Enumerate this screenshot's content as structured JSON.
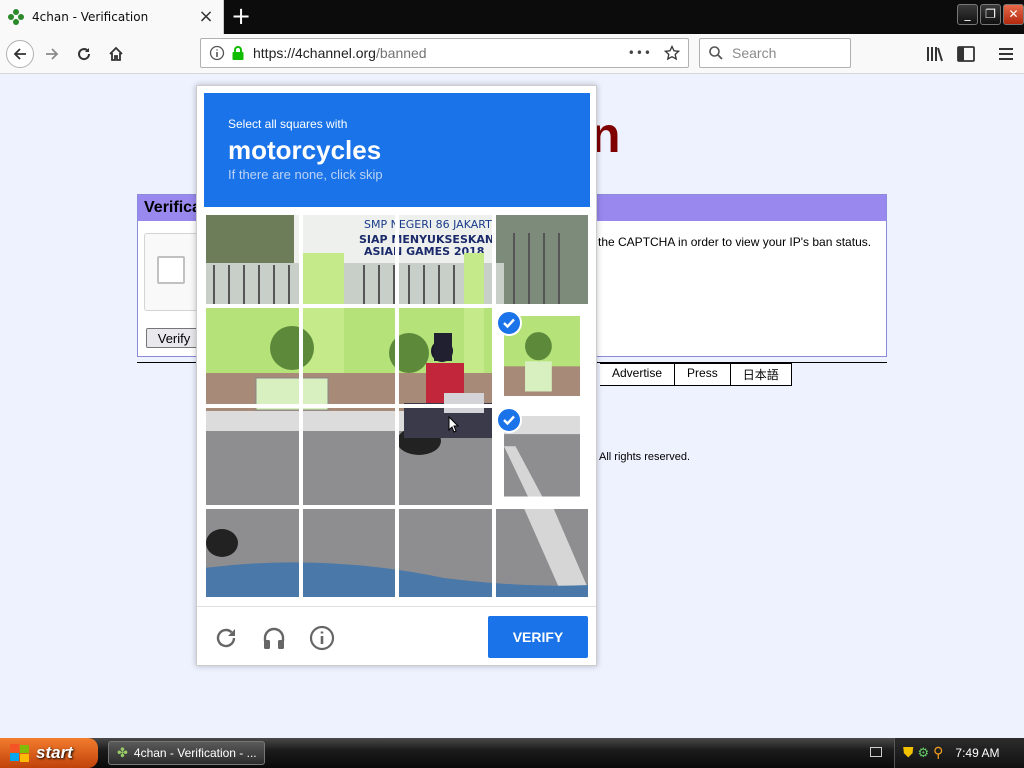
{
  "browser": {
    "tab_title": "4chan - Verification",
    "tab_close": "×",
    "new_tab": "+",
    "url_host": "https://4channel.org",
    "url_path": "/banned",
    "url_menu": "•••",
    "search_placeholder": "Search"
  },
  "page": {
    "logo": "n",
    "box_title": "Verifica",
    "box_text": "the CAPTCHA in order to view your IP's ban status.",
    "verify_button": "Verify",
    "footer_links": [
      "Advertise",
      "Press",
      "日本語"
    ],
    "rights": "All rights reserved."
  },
  "captcha": {
    "instruction": "Select all squares with",
    "target": "motorcycles",
    "hint": "If there are none, click skip",
    "scene_banner_1": "SMP NEGERI 86 JAKART",
    "scene_banner_2": "SIAP MENYUKSESKAN",
    "scene_banner_3": "ASIAN GAMES 2018",
    "verify_label": "VERIFY",
    "selected_tiles": [
      7,
      11
    ]
  },
  "taskbar": {
    "start": "start",
    "task_item": "4chan - Verification - ...",
    "clock": "7:49 AM"
  },
  "colors": {
    "captcha_blue": "#1a73e8",
    "box_header": "#9988ee",
    "logo": "#800000"
  }
}
